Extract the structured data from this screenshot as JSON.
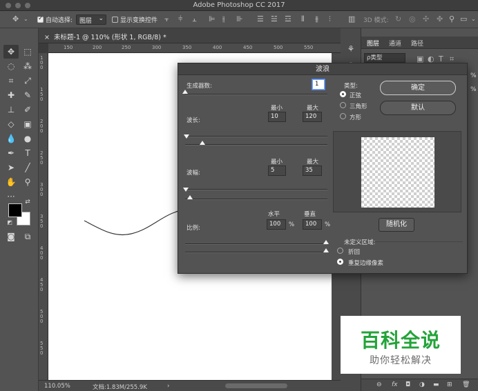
{
  "app": {
    "title": "Adobe Photoshop CC 2017"
  },
  "options_bar": {
    "auto_select_label": "自动选择:",
    "auto_select_value": "图层",
    "show_transform_label": "显示变换控件",
    "mode_3d_label": "3D 模式:"
  },
  "document": {
    "tab_title": "未标题-1 @ 110% (形状 1, RGB/8) *",
    "close_glyph": "×",
    "ruler_h": [
      "150",
      "200",
      "250",
      "300",
      "350",
      "400",
      "450",
      "500",
      "550"
    ],
    "ruler_v": [
      "1 0 0",
      "1 5 0",
      "2 0 0",
      "2 5 0",
      "3 0 0",
      "3 5 0",
      "4 0 0",
      "4 5 0",
      "5 0 0",
      "5 5 0"
    ],
    "zoom": "110.05%",
    "doc_size": "文档:1.83M/255.9K",
    "arrow": "›"
  },
  "layers_panel": {
    "tabs": [
      "图层",
      "通道",
      "路径"
    ],
    "filter": "ρ类型",
    "partial_right_1": "%",
    "partial_right_2": "%"
  },
  "wave_dialog": {
    "title": "波浪",
    "generators_label": "生成器数:",
    "generators_value": "1",
    "wavelength_label": "波长:",
    "amplitude_label": "波幅:",
    "min_label": "最小",
    "max_label": "最大",
    "wavelength_min": "10",
    "wavelength_max": "120",
    "amplitude_min": "5",
    "amplitude_max": "35",
    "scale_label": "比例:",
    "horizontal_label": "水平",
    "vertical_label": "垂直",
    "scale_h": "100",
    "scale_v": "100",
    "percent": "%",
    "type_label": "类型:",
    "types": [
      "正弦",
      "三角形",
      "方形"
    ],
    "type_selected": 0,
    "ok_label": "确定",
    "default_label": "默认",
    "randomize_label": "随机化",
    "undefined_area_label": "未定义区域:",
    "undefined_options": [
      "折回",
      "重复边缘像素"
    ],
    "undefined_selected": 1
  },
  "watermark": {
    "line1": "百科全说",
    "line2": "助你轻松解决"
  }
}
